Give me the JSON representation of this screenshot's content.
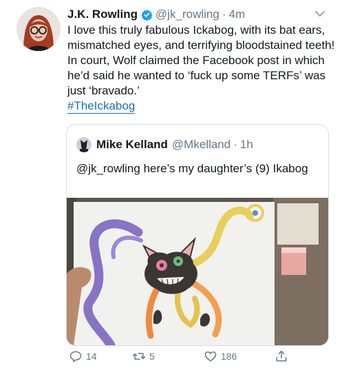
{
  "tweet": {
    "author": {
      "name": "J.K. Rowling",
      "handle": "@jk_rowling",
      "time": "4m"
    },
    "text": "I love this truly fabulous Ickabog, with its bat ears, mismatched eyes, and terrifying bloodstained teeth! In court, Wolf claimed the Facebook post in which he’d said he wanted to ‘fuck up some TERFs’ was just ‘bravado.’",
    "hashtag": "#TheIckabog"
  },
  "quoted": {
    "author": {
      "name": "Mike Kelland",
      "handle": "@Mkelland",
      "time": "1h"
    },
    "text": "@jk_rowling here’s my daughter’s (9) Ikabog"
  },
  "actions": {
    "replies": "14",
    "retweets": "5",
    "likes": "186"
  },
  "colors": {
    "link": "#1b6fb3",
    "verified": "#1da1f2",
    "secondary": "#657786"
  },
  "icons": [
    "verified-badge-icon",
    "chevron-down-icon",
    "reply-icon",
    "retweet-icon",
    "like-icon",
    "share-icon"
  ]
}
